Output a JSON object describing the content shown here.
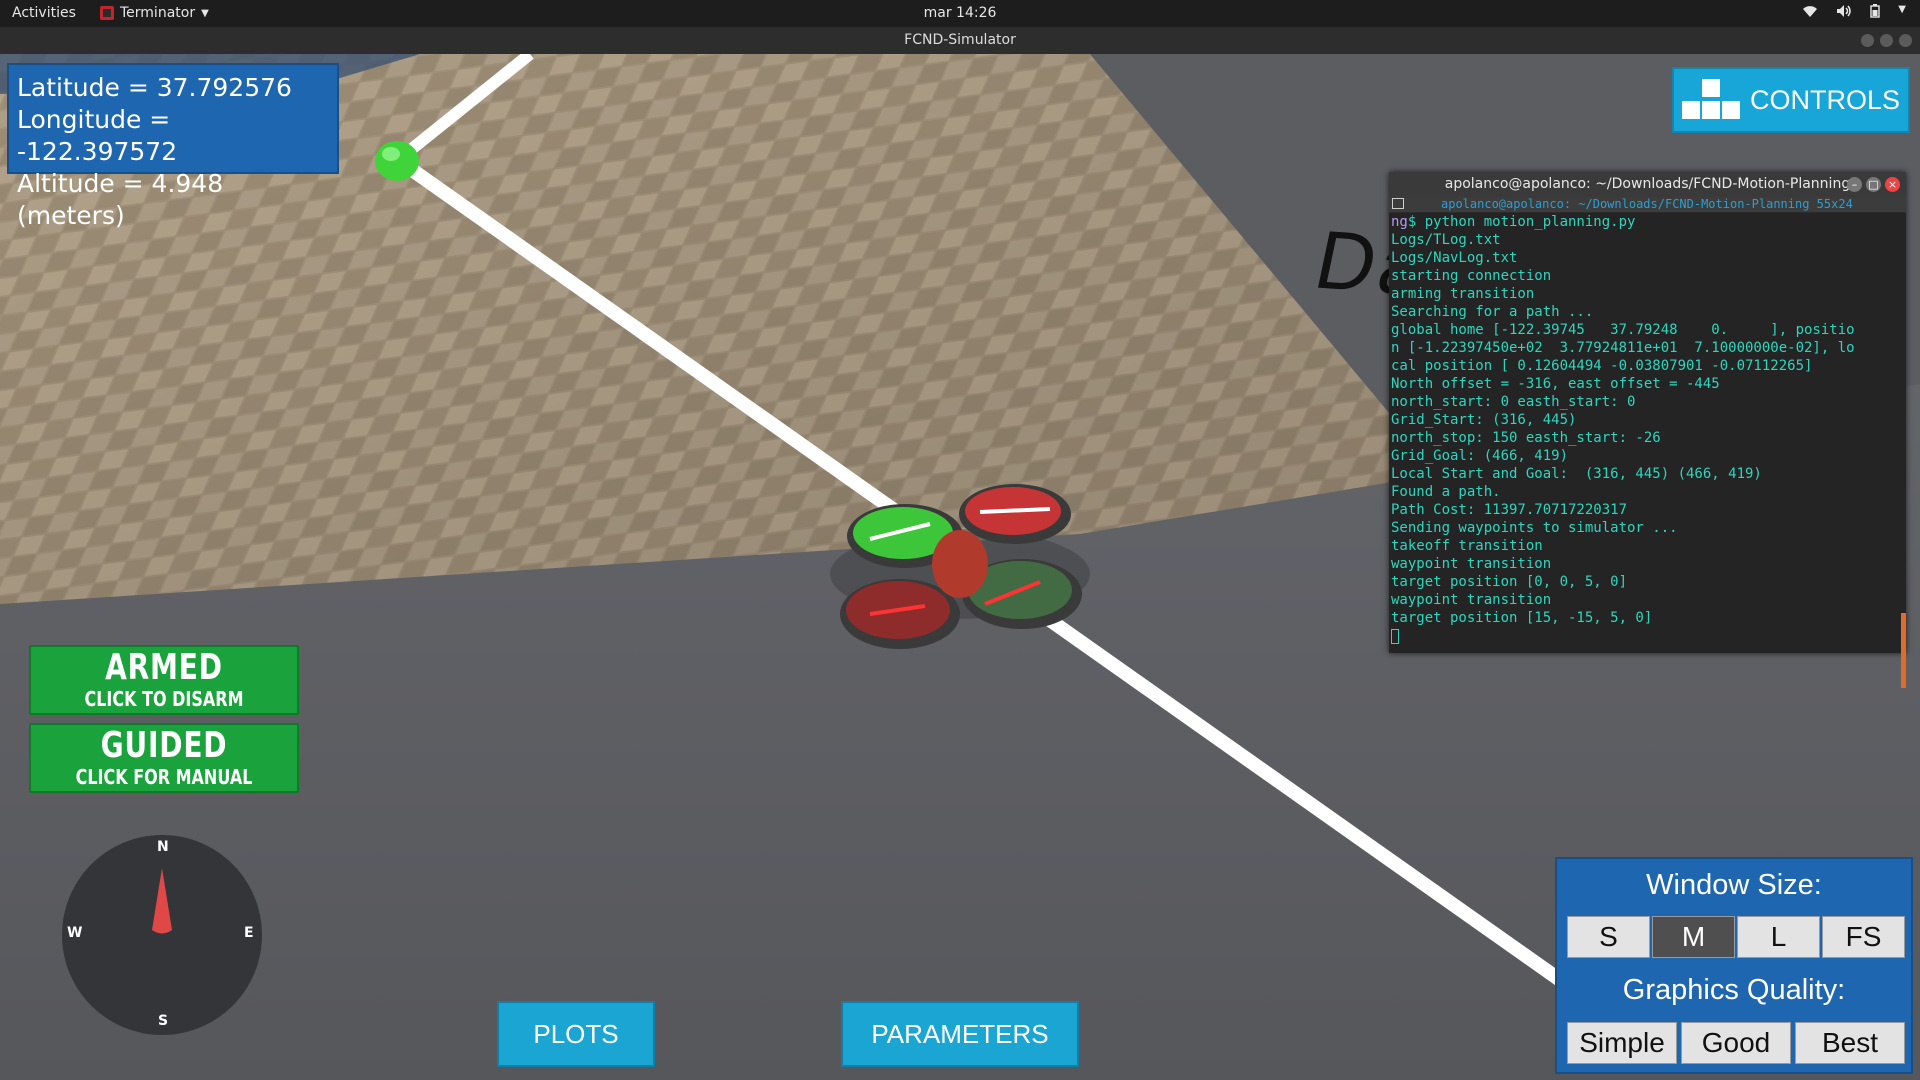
{
  "topbar": {
    "activities": "Activities",
    "app_name": "Terminator",
    "clock": "mar 14:26"
  },
  "window": {
    "title": "FCND-Simulator"
  },
  "position": {
    "latitude": "Latitude = 37.792576",
    "longitude": "Longitude = -122.397572",
    "altitude": "Altitude = 4.948 (meters)"
  },
  "controls_label": "CONTROLS",
  "status": {
    "armed": "ARMED",
    "armed_sub": "CLICK TO DISARM",
    "guided": "GUIDED",
    "guided_sub": "CLICK FOR MANUAL"
  },
  "compass": {
    "n": "N",
    "e": "E",
    "s": "S",
    "w": "W"
  },
  "bottom_buttons": {
    "plots": "PLOTS",
    "parameters": "PARAMETERS"
  },
  "window_panel": {
    "size_title": "Window Size:",
    "size_options": [
      "S",
      "M",
      "L",
      "FS"
    ],
    "size_selected": "M",
    "quality_title": "Graphics Quality:",
    "quality_options": [
      "Simple",
      "Good",
      "Best"
    ]
  },
  "street_sign": "Davis St",
  "terminal": {
    "title": "apolanco@apolanco: ~/Downloads/FCND-Motion-Planning",
    "subtitle": "apolanco@apolanco: ~/Downloads/FCND-Motion-Planning 55x24",
    "prompt_prefix": "ng",
    "command": "$ python motion_planning.py",
    "lines": [
      "Logs/TLog.txt",
      "Logs/NavLog.txt",
      "starting connection",
      "arming transition",
      "Searching for a path ...",
      "global home [-122.39745   37.79248    0.     ], positio",
      "n [-1.22397450e+02  3.77924811e+01  7.10000000e-02], lo",
      "cal position [ 0.12604494 -0.03807901 -0.07112265]",
      "North offset = -316, east offset = -445",
      "north_start: 0 easth_start: 0",
      "Grid_Start: (316, 445)",
      "north_stop: 150 easth_start: -26",
      "Grid_Goal: (466, 419)",
      "Local Start and Goal:  (316, 445) (466, 419)",
      "Found a path.",
      "Path Cost: 11397.70717220317",
      "Sending waypoints to simulator ...",
      "takeoff transition",
      "waypoint transition",
      "target position [0, 0, 5, 0]",
      "waypoint transition",
      "target position [15, -15, 5, 0]"
    ]
  }
}
